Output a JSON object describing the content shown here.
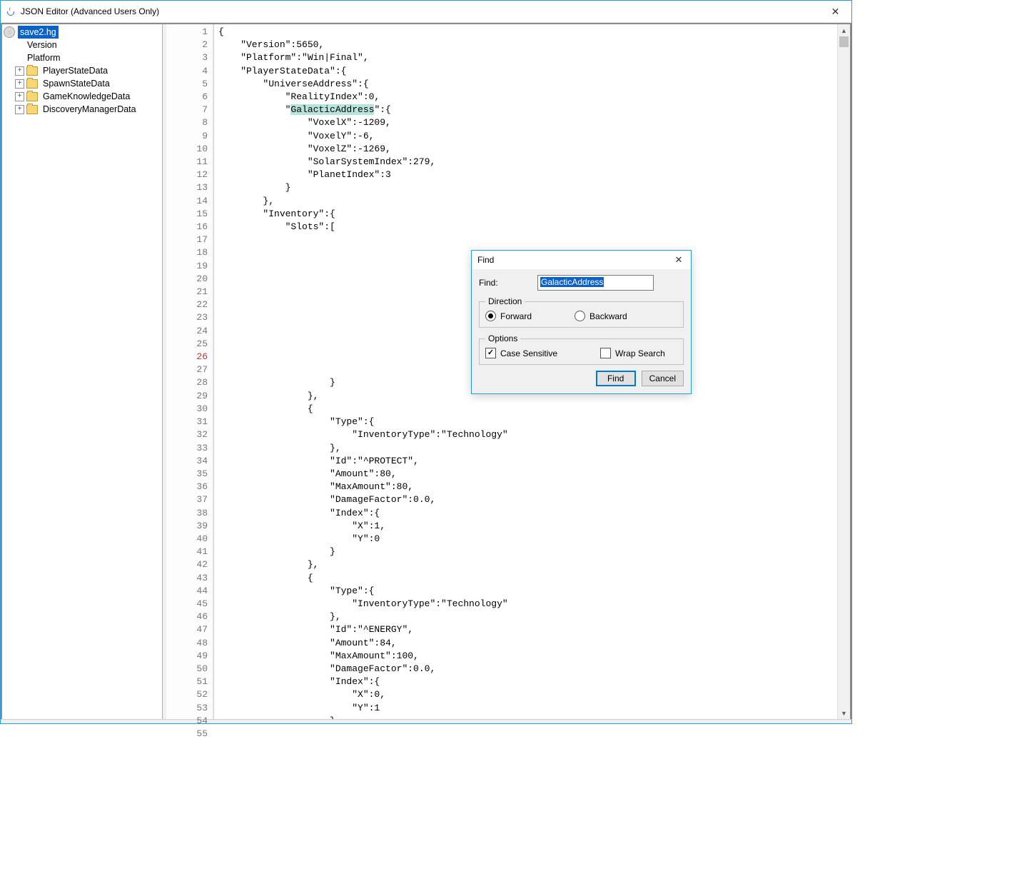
{
  "window": {
    "title": "JSON Editor (Advanced Users Only)"
  },
  "tree": {
    "root": "save2.hg",
    "items": [
      {
        "label": "Version",
        "expandable": false
      },
      {
        "label": "Platform",
        "expandable": false
      },
      {
        "label": "PlayerStateData",
        "expandable": true
      },
      {
        "label": "SpawnStateData",
        "expandable": true
      },
      {
        "label": "GameKnowledgeData",
        "expandable": true
      },
      {
        "label": "DiscoveryManagerData",
        "expandable": true
      }
    ]
  },
  "editor": {
    "current_line": 26,
    "highlight_text": "GalacticAddress",
    "lines": [
      "{",
      "    \"Version\":5650,",
      "    \"Platform\":\"Win|Final\",",
      "    \"PlayerStateData\":{",
      "        \"UniverseAddress\":{",
      "            \"RealityIndex\":0,",
      "            \"GalacticAddress\":{",
      "                \"VoxelX\":-1209,",
      "                \"VoxelY\":-6,",
      "                \"VoxelZ\":-1269,",
      "                \"SolarSystemIndex\":279,",
      "                \"PlanetIndex\":3",
      "            }",
      "        },",
      "        \"Inventory\":{",
      "            \"Slots\":[",
      "",
      "",
      "",
      "",
      "",
      "",
      "",
      "",
      "",
      "",
      "",
      "                    }",
      "                },",
      "                {",
      "                    \"Type\":{",
      "                        \"InventoryType\":\"Technology\"",
      "                    },",
      "                    \"Id\":\"^PROTECT\",",
      "                    \"Amount\":80,",
      "                    \"MaxAmount\":80,",
      "                    \"DamageFactor\":0.0,",
      "                    \"Index\":{",
      "                        \"X\":1,",
      "                        \"Y\":0",
      "                    }",
      "                },",
      "                {",
      "                    \"Type\":{",
      "                        \"InventoryType\":\"Technology\"",
      "                    },",
      "                    \"Id\":\"^ENERGY\",",
      "                    \"Amount\":84,",
      "                    \"MaxAmount\":100,",
      "                    \"DamageFactor\":0.0,",
      "                    \"Index\":{",
      "                        \"X\":0,",
      "                        \"Y\":1",
      "                    }",
      "                },"
    ]
  },
  "find_dialog": {
    "title": "Find",
    "find_label": "Find:",
    "find_value": "GalacticAddress",
    "direction_legend": "Direction",
    "direction_forward": "Forward",
    "direction_backward": "Backward",
    "direction_selected": "forward",
    "options_legend": "Options",
    "case_sensitive_label": "Case Sensitive",
    "case_sensitive_checked": true,
    "wrap_search_label": "Wrap Search",
    "wrap_search_checked": false,
    "find_button": "Find",
    "cancel_button": "Cancel"
  }
}
